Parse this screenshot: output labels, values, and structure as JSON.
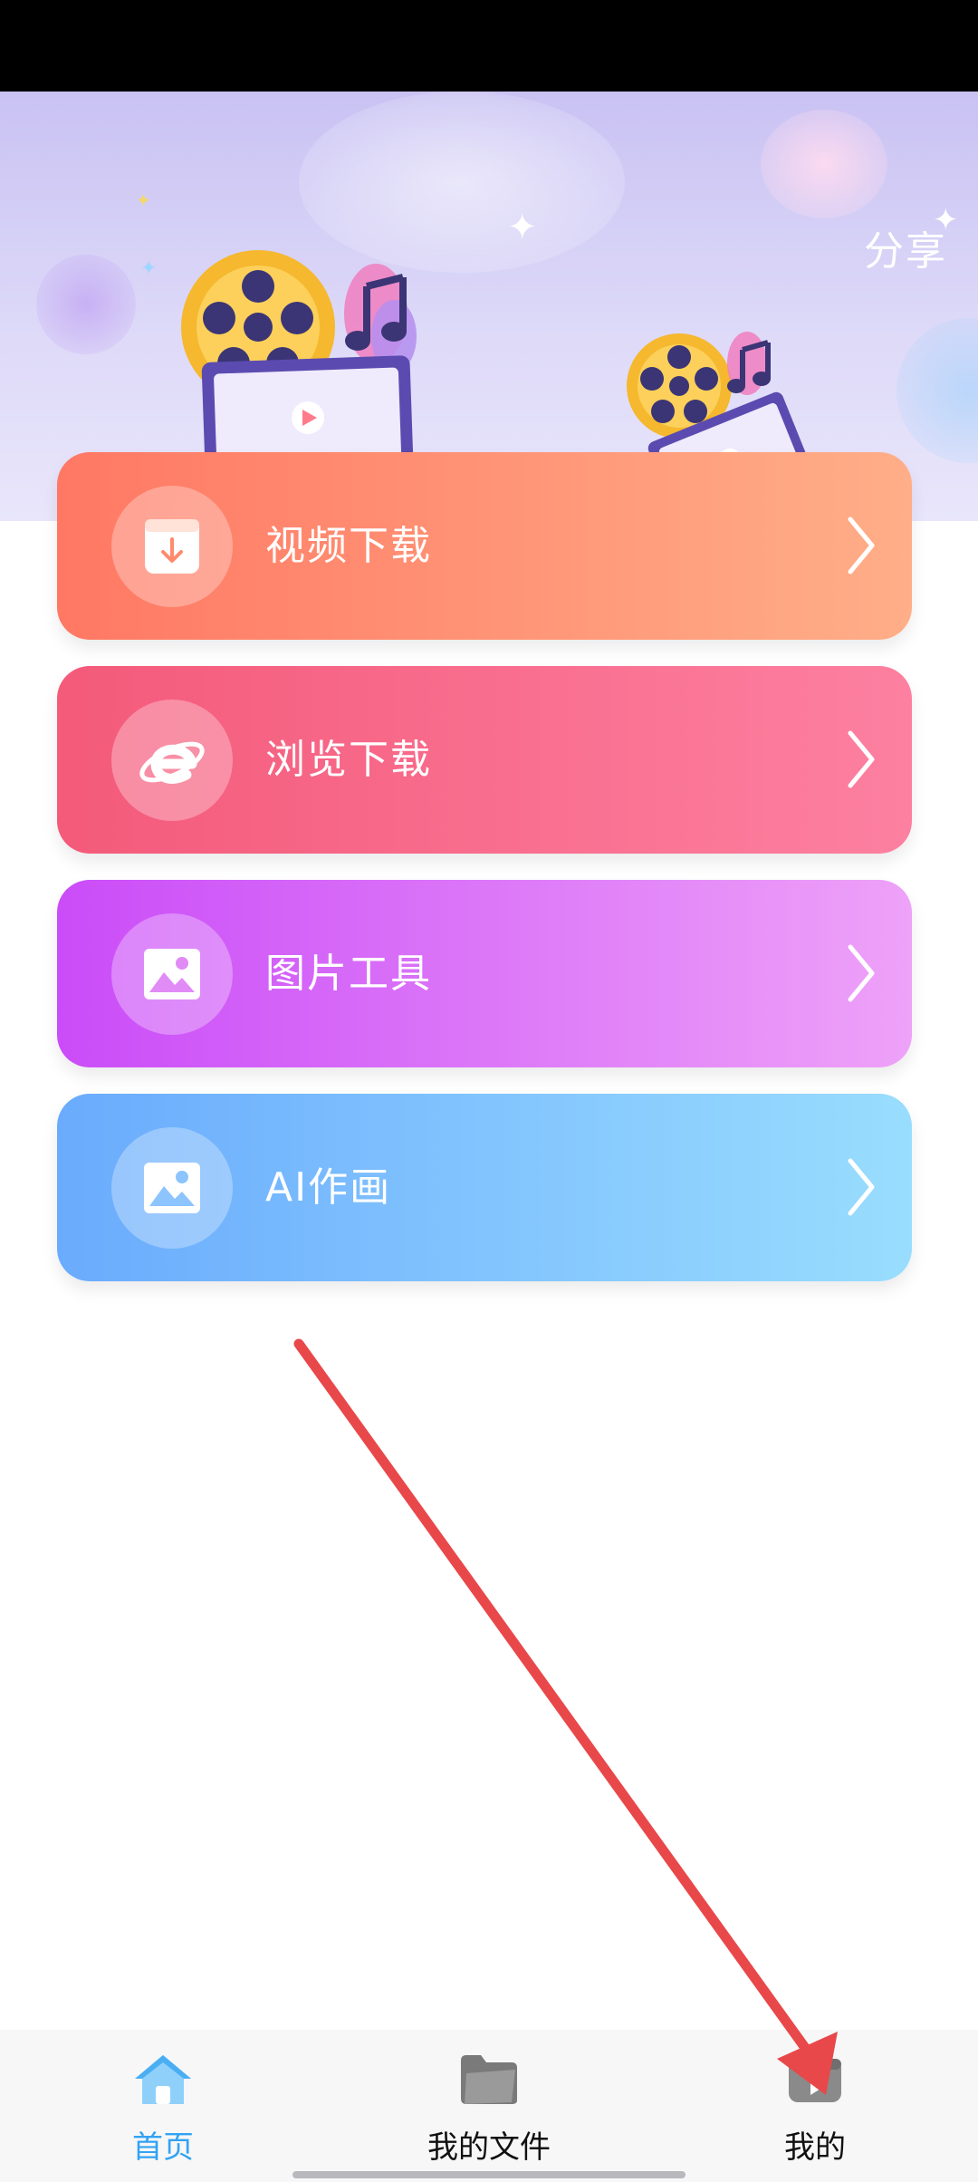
{
  "status_bar": {},
  "banner": {
    "share_label": "分享"
  },
  "cards": [
    {
      "label": "视频下载",
      "icon": "download-box-icon",
      "color_start": "#ff7863",
      "color_end": "#ffae88"
    },
    {
      "label": "浏览下载",
      "icon": "browser-e-icon",
      "color_start": "#f45a7a",
      "color_end": "#fd80a1"
    },
    {
      "label": "图片工具",
      "icon": "image-icon",
      "color_start": "#ca4cf8",
      "color_end": "#eea2f8"
    },
    {
      "label": "AI作画",
      "icon": "image-icon",
      "color_start": "#6aabfd",
      "color_end": "#99ddfe"
    }
  ],
  "tabbar": {
    "items": [
      {
        "label": "首页",
        "icon": "home-icon",
        "active": true
      },
      {
        "label": "我的文件",
        "icon": "folder-icon",
        "active": false
      },
      {
        "label": "我的",
        "icon": "video-icon",
        "active": false
      }
    ],
    "active_color": "#33a3f2"
  },
  "annotation": {
    "type": "arrow",
    "color": "#e8484a"
  }
}
